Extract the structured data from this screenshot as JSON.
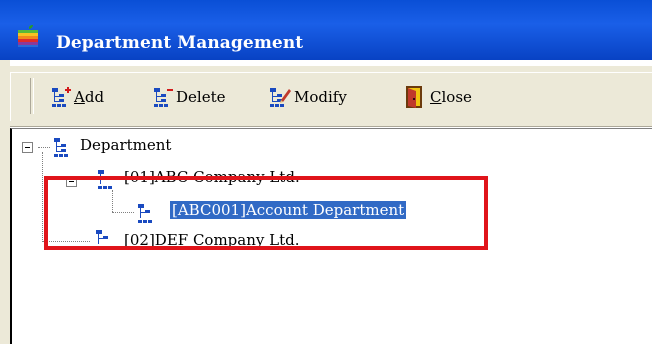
{
  "window": {
    "title": "Department Management"
  },
  "toolbar": {
    "add_label": "Add",
    "add_underline": "A",
    "delete_label": "Delete",
    "modify_label": "Modify",
    "close_label": "Close",
    "close_underline": "C"
  },
  "tree": {
    "root": "Department",
    "nodes": [
      {
        "label": "[01]ABC Company Ltd."
      },
      {
        "label": "[ABC001]Account Department",
        "selected": true
      },
      {
        "label": "[02]DEF Company Ltd."
      }
    ]
  },
  "colors": {
    "title_bar": "#0a4fd6",
    "selection": "#316ac5",
    "highlight_box": "#e0141a"
  }
}
